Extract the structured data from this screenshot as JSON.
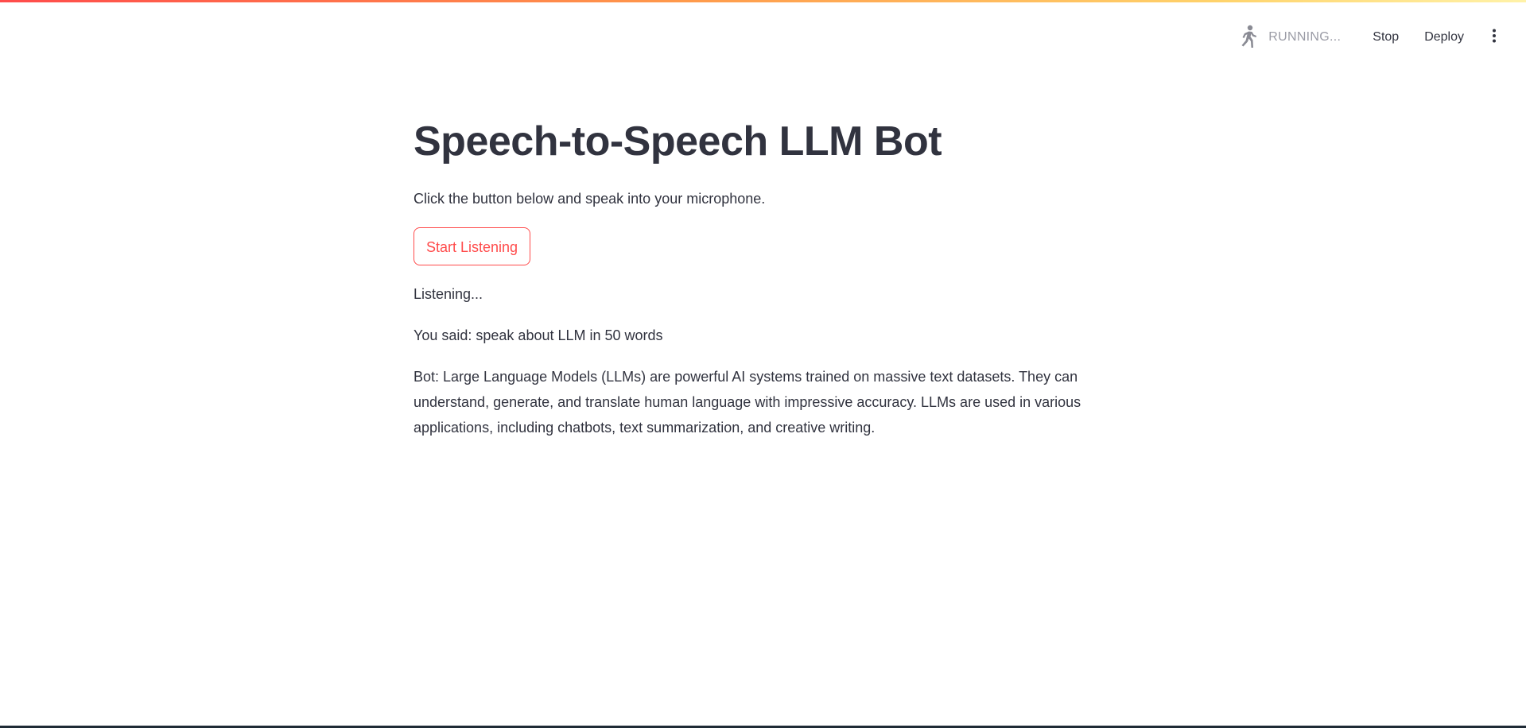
{
  "header": {
    "status_text": "RUNNING...",
    "running_icon": "running-man-icon",
    "stop_label": "Stop",
    "deploy_label": "Deploy",
    "menu_icon": "kebab-menu-icon"
  },
  "main": {
    "title": "Speech-to-Speech LLM Bot",
    "instruction": "Click the button below and speak into your microphone.",
    "button_label": "Start Listening",
    "listening_status": "Listening...",
    "you_said": "You said: speak about LLM in 50 words",
    "bot_response": "Bot: Large Language Models (LLMs) are powerful AI systems trained on massive text datasets. They can understand, generate, and translate human language with impressive accuracy. LLMs are used in various applications, including chatbots, text summarization, and creative writing."
  },
  "colors": {
    "accent": "#ff4b4b",
    "text": "#31333f",
    "muted": "#9a9ba5"
  }
}
